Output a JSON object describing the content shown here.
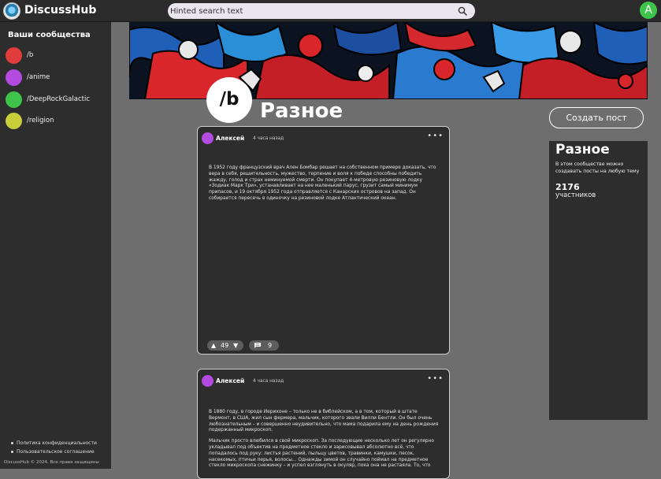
{
  "app": {
    "name": "DiscussHub",
    "user_initial": "A",
    "accent": "#3ec44a"
  },
  "search": {
    "placeholder": "Hinted search text",
    "icon": "search-icon"
  },
  "sidebar": {
    "title": "Ваши сообщества",
    "communities": [
      {
        "label": "/b",
        "color": "#e03c3c"
      },
      {
        "label": "/anime",
        "color": "#b44be0"
      },
      {
        "label": "/DeepRockGalactic",
        "color": "#3ec44a"
      },
      {
        "label": "/religion",
        "color": "#c9cf3a"
      }
    ],
    "footer": {
      "privacy": "Политика конфиденциальности",
      "terms": "Пользовательское соглашение",
      "copyright": "DiscussHub © 2024. Все права защищены"
    }
  },
  "community": {
    "avatar_text": "/b",
    "title": "Разное",
    "create_post_label": "Создать пост"
  },
  "info": {
    "title": "Разное",
    "description": "В этом сообществе можно создавать посты на любую тему",
    "members_count": "2176",
    "members_label": "участников"
  },
  "posts": [
    {
      "author": "Алексей",
      "time": "4 часа назад",
      "author_color": "#b44be0",
      "paragraphs": [
        "В 1952 году французский врач Ален Бомбар решает на собственном примере доказать, что вера в себя, решительность, мужество, терпение и воля к  победе способны победить жажду, голод и страх неминуемой смерти. Он  покупает 4-метровую резиновую лодку «Зодиак Марк Три», устанавливает на  нее маленький парус, грузит самый минимум припасов, и 19 октября 1952  года отправляется с Канарских островов на запад. Он собирается пересечь в  одиночку на резиновой лодке Атлантический океан."
      ],
      "votes": "49",
      "comments": "9"
    },
    {
      "author": "Алексей",
      "time": "4 часа назад",
      "author_color": "#b44be0",
      "paragraphs": [
        "В 1880 году, в городе Иерихоне – только не в библейском, а в  том, который в штате Вермонт, в США, жил сын фермера, мальчик, которого  звали Вилли Бентли. Он был очень любознательным – и совершенно  неудивительно, что мама подарила ему на день рождения подержанный  микроскоп.",
        "Мальчик просто влюбился в свой микроскоп. За последующие  несколько лет он регулярно укладывал под объектив на предметное стекло и  зарисовывал абсолютно всё, что попадалось под руку: листья растений,  пыльцу цветов, травинки, камушки, песок, насекомых, птичьи перья,  волосы... Однажды зимой он случайно поймал на предметное стекло  микроскопа снежинку – и успел взглянуть в окуляр, пока она не растаяла. То, что"
      ]
    }
  ]
}
